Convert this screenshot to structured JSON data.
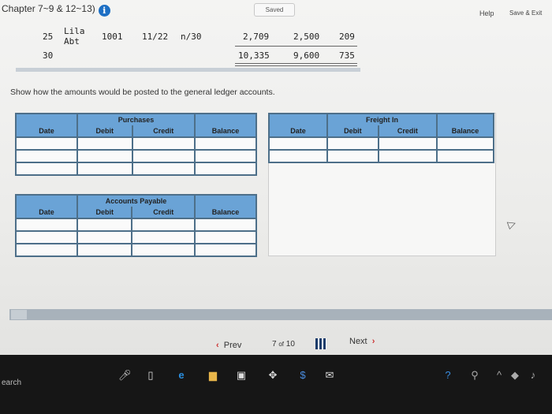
{
  "header": {
    "title": "Chapter 7~9 & 12~13)",
    "saved": "Saved",
    "help": "Help",
    "save_exit": "Save & Exit"
  },
  "journal": {
    "row1": {
      "day": "25",
      "name_line1": "Lila",
      "name_line2": "Abt",
      "invoice": "1001",
      "date": "11/22",
      "terms": "n/30",
      "amount1": "2,709",
      "amount2": "2,500",
      "amount3": "209"
    },
    "row2": {
      "day": "30",
      "amount1": "10,335",
      "amount2": "9,600",
      "amount3": "735"
    }
  },
  "instruction": "Show how the amounts would be posted to the general ledger accounts.",
  "ledgers": {
    "purchases": {
      "title": "Purchases",
      "cols": [
        "Date",
        "Debit",
        "Credit",
        "Balance"
      ]
    },
    "freight_in": {
      "title": "Freight In",
      "cols": [
        "Date",
        "Debit",
        "Credit",
        "Balance"
      ]
    },
    "accounts_payable": {
      "title": "Accounts Payable",
      "cols": [
        "Date",
        "Debit",
        "Credit",
        "Balance"
      ]
    }
  },
  "nav": {
    "prev": "Prev",
    "page_current": "7",
    "page_of": "of",
    "page_total": "10",
    "next": "Next"
  },
  "taskbar": {
    "search": "earch"
  },
  "colors": {
    "table_header": "#6aa3d6",
    "table_border": "#4d6f89",
    "info_icon": "#1d6fc4"
  }
}
